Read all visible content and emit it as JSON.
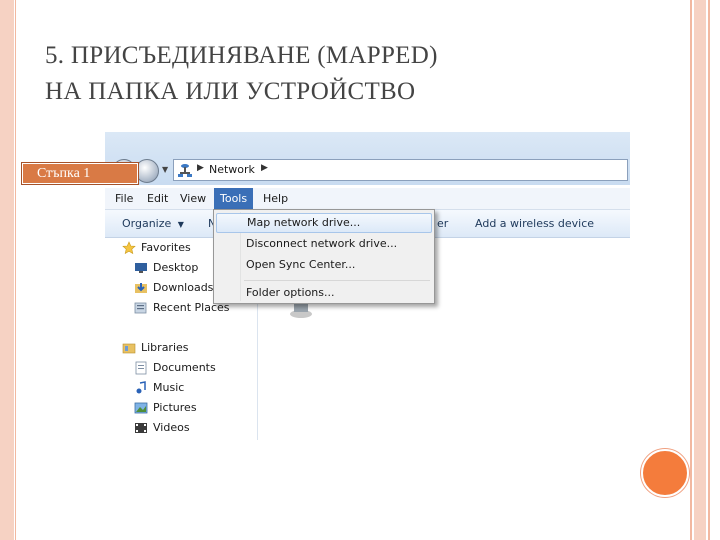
{
  "slide": {
    "title_line1": "5. ПРИСЪЕДИНЯВАНЕ (MAPPED)",
    "title_line2": "НА ПАПКА ИЛИ УСТРОЙСТВО",
    "callout": "Стъпка 1",
    "accent_color": "#f47c3c"
  },
  "explorer": {
    "address": {
      "location": "Network",
      "icon": "network-icon"
    },
    "menu": [
      "File",
      "Edit",
      "View",
      "Tools",
      "Help"
    ],
    "menu_active": "Tools",
    "commands": {
      "organize": "Organize",
      "partial_left": "N",
      "partial_right": "er",
      "add_wireless": "Add a wireless device"
    },
    "tools_menu": [
      {
        "label": "Map network drive...",
        "highlighted": true
      },
      {
        "label": "Disconnect network drive...",
        "highlighted": false
      },
      {
        "label": "Open Sync Center...",
        "highlighted": false
      },
      {
        "label": "Folder options...",
        "highlighted": false
      }
    ],
    "nav_pane": {
      "favorites": {
        "label": "Favorites",
        "items": [
          {
            "label": "Desktop",
            "icon": "desktop-icon"
          },
          {
            "label": "Downloads",
            "icon": "downloads-icon"
          },
          {
            "label": "Recent Places",
            "icon": "recent-places-icon"
          }
        ]
      },
      "libraries": {
        "label": "Libraries",
        "items": [
          {
            "label": "Documents",
            "icon": "documents-icon"
          },
          {
            "label": "Music",
            "icon": "music-icon"
          },
          {
            "label": "Pictures",
            "icon": "pictures-icon"
          },
          {
            "label": "Videos",
            "icon": "videos-icon"
          }
        ]
      }
    }
  }
}
